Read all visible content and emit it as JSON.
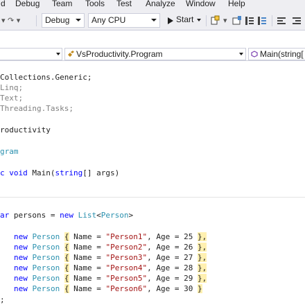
{
  "menu": {
    "items": [
      "d",
      "Debug",
      "Team",
      "Tools",
      "Test",
      "Analyze",
      "Window",
      "Help"
    ]
  },
  "toolbar": {
    "config_value": "Debug",
    "platform_value": "Any CPU",
    "start_label": "Start"
  },
  "navbar": {
    "member_value": "VsProductivity.Program",
    "method_value": "Main(string["
  },
  "code": {
    "line1": "Collections.Generic;",
    "line2": "Linq;",
    "line3": "Text;",
    "line4": "Threading.Tasks;",
    "line5": "roductivity",
    "line6": "gram",
    "line7": {
      "a": "c void ",
      "b": "Main",
      "c": "(",
      "d": "string",
      "e": "[] args",
      "f": ")"
    },
    "line8": {
      "a": "ar",
      "b": " persons = ",
      "c": "new",
      "d": " ",
      "e": "List",
      "f": "<",
      "g": "Person",
      "h": ">"
    },
    "persons": [
      {
        "name": "\"Person1\"",
        "age": "25",
        "end": "},"
      },
      {
        "name": "\"Person2\"",
        "age": "26",
        "end": "},"
      },
      {
        "name": "\"Person3\"",
        "age": "27",
        "end": "},"
      },
      {
        "name": "\"Person4\"",
        "age": "28",
        "end": "},"
      },
      {
        "name": "\"Person5\"",
        "age": "29",
        "end": "},"
      },
      {
        "name": "\"Person6\"",
        "age": "30",
        "end": "}"
      }
    ],
    "row_new": "new",
    "row_type": "Person",
    "row_open": "{",
    "row_name_key": " Name = ",
    "row_age_key": ", Age = ",
    "last": ";"
  },
  "colors": {
    "keyword": "#0000ff",
    "type": "#2b91af",
    "string": "#a31515",
    "comment_gray": "#808080",
    "chrome": "#eeeef2"
  }
}
